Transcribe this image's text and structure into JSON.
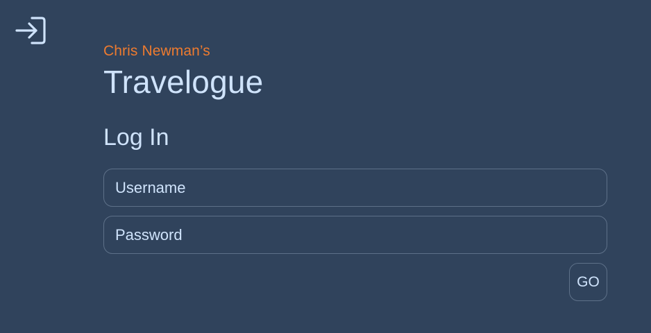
{
  "header": {
    "icon": "login-icon"
  },
  "brand": {
    "owner": "Chris Newman’s",
    "title": "Travelogue"
  },
  "login": {
    "heading": "Log In",
    "username": {
      "value": "",
      "placeholder": "Username"
    },
    "password": {
      "value": "",
      "placeholder": "Password"
    },
    "submit_label": "GO"
  },
  "colors": {
    "background": "#30435c",
    "accent": "#ee7b2f",
    "text": "#cfe3fb",
    "border": "#5e7189"
  }
}
